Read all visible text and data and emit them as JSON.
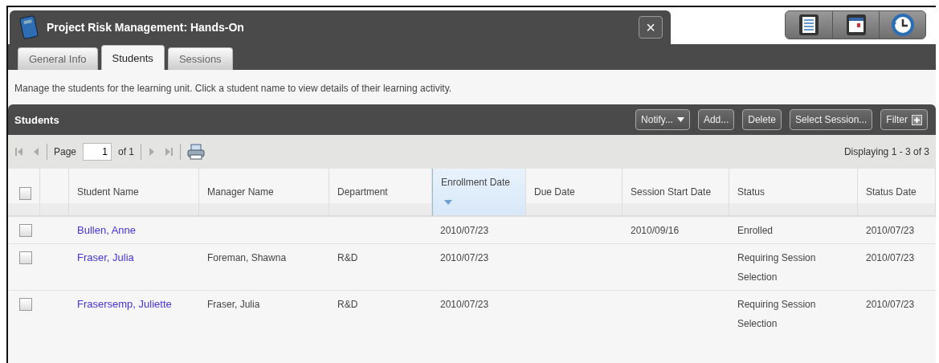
{
  "window": {
    "title": "Project Risk Management: Hands-On",
    "close": "×"
  },
  "tabs": [
    {
      "label": "General Info",
      "selected": false
    },
    {
      "label": "Students",
      "selected": true
    },
    {
      "label": "Sessions",
      "selected": false
    }
  ],
  "view_buttons": [
    {
      "kind": "list"
    },
    {
      "kind": "calendar"
    },
    {
      "kind": "history"
    }
  ],
  "description": "Manage the students for the learning unit. Click a student name to view details of their learning activity.",
  "panel": {
    "title": "Students",
    "buttons": [
      {
        "label": "Notify...",
        "kind": "dropdown"
      },
      {
        "label": "Add...",
        "kind": "plain"
      },
      {
        "label": "Delete",
        "kind": "plain"
      },
      {
        "label": "Select Session...",
        "kind": "plain"
      },
      {
        "label": "Filter",
        "kind": "plus"
      }
    ]
  },
  "pager": {
    "page_label": "Page",
    "page": "1",
    "of": "of 1",
    "displaying": "Displaying 1 - 3 of 3"
  },
  "table": {
    "select_all": {
      "checked": false
    },
    "columns": [
      {
        "label": "Student Name",
        "sorted": false
      },
      {
        "label": "Manager Name",
        "sorted": false
      },
      {
        "label": "Department",
        "sorted": false
      },
      {
        "label": "Enrollment Date",
        "sorted": true
      },
      {
        "label": "Due Date",
        "sorted": false
      },
      {
        "label": "Session Start Date",
        "sorted": false
      },
      {
        "label": "Status",
        "sorted": false
      },
      {
        "label": "Status Date",
        "sorted": false
      }
    ],
    "rows": [
      {
        "checked": false,
        "cells": [
          "Bullen, Anne",
          "",
          "",
          "2010/07/23",
          "",
          "2010/09/16",
          "Enrolled",
          "2010/07/23"
        ]
      },
      {
        "checked": false,
        "cells": [
          "Fraser, Julia",
          "Foreman, Shawna",
          "R&D",
          "2010/07/23",
          "",
          "",
          "Requiring Session Selection",
          "2010/07/23"
        ]
      },
      {
        "checked": false,
        "cells": [
          "Frasersemp, Juliette",
          "Fraser, Julia",
          "R&D",
          "2010/07/23",
          "",
          "",
          "Requiring Session Selection",
          "2010/07/23"
        ]
      }
    ]
  }
}
